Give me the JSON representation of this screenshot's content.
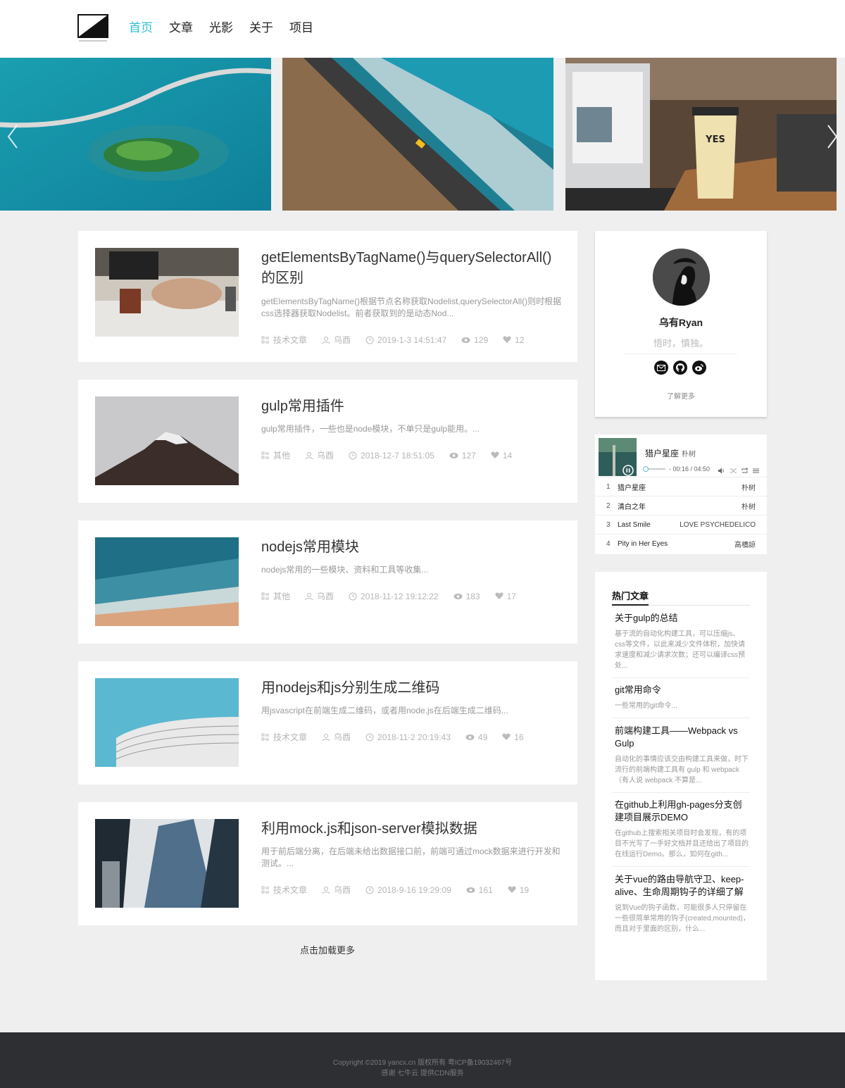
{
  "nav": {
    "items": [
      "首页",
      "文章",
      "光影",
      "关于",
      "项目"
    ]
  },
  "articles": [
    {
      "title": "getElementsByTagName()与querySelectorAll()的区别",
      "summary": "getElementsByTagName()根据节点名称获取Nodelist,querySelectorAll()则时根据css选择器获取Nodelist。前者获取到的是动态Nod...",
      "category": "技术文章",
      "author": "乌酉",
      "date": "2019-1-3 14:51:47",
      "views": "129",
      "likes": "12"
    },
    {
      "title": "gulp常用插件",
      "summary": "gulp常用插件，一些也是node模块，不单只是gulp能用。...",
      "category": "其他",
      "author": "乌酉",
      "date": "2018-12-7 18:51:05",
      "views": "127",
      "likes": "14"
    },
    {
      "title": "nodejs常用模块",
      "summary": "nodejs常用的一些模块、资料和工具等收集...",
      "category": "其他",
      "author": "乌酉",
      "date": "2018-11-12 19:12:22",
      "views": "183",
      "likes": "17"
    },
    {
      "title": "用nodejs和js分别生成二维码",
      "summary": "用jsvascript在前端生成二维码，或者用node.js在后端生成二维码...",
      "category": "技术文章",
      "author": "乌酉",
      "date": "2018-11-2 20:19:43",
      "views": "49",
      "likes": "16"
    },
    {
      "title": "利用mock.js和json-server模拟数据",
      "summary": "用于前后端分离，在后端未给出数据接口前，前端可通过mock数据来进行开发和测试。...",
      "category": "技术文章",
      "author": "乌酉",
      "date": "2018-9-16 19:29:09",
      "views": "161",
      "likes": "19"
    }
  ],
  "load_more": "点击加载更多",
  "profile": {
    "name": "乌有Ryan",
    "motto": "悟时，慎独。",
    "more": "了解更多"
  },
  "player": {
    "song": "猎户星座",
    "artist": "朴树",
    "time": "- 00:16 / 04:50",
    "progress": 0.06,
    "playlist": [
      {
        "num": "1",
        "name": "猎户星座",
        "artist": "朴树"
      },
      {
        "num": "2",
        "name": "清白之年",
        "artist": "朴树"
      },
      {
        "num": "3",
        "name": "Last Smile",
        "artist": "LOVE PSYCHEDELICO"
      },
      {
        "num": "4",
        "name": "Pity in Her Eyes",
        "artist": "高橋諒"
      }
    ]
  },
  "hot": {
    "heading": "热门文章",
    "items": [
      {
        "title": "关于gulp的总结",
        "summary": "基于流的自动化构建工具，可以压缩js、css等文件，以此来减少文件体积，加快请求速度和减少请求次数；还可以编译css预处..."
      },
      {
        "title": "git常用命令",
        "summary": "一些常用的git命令..."
      },
      {
        "title": "前端构建工具——Webpack vs Gulp",
        "summary": "自动化的事情应该交由构建工具来做，时下流行的前端构建工具有 gulp 和 webpack（有人说 webpack 不算是..."
      },
      {
        "title": "在github上利用gh-pages分支创建项目展示DEMO",
        "summary": "在github上搜索相关项目时会发现，有的项目不光写了一手好文档并且还给出了项目的在线运行Demo。那么，如何在gith..."
      },
      {
        "title": "关于vue的路由导航守卫、keep-alive、生命周期钩子的详细了解",
        "summary": "说到Vue的钩子函数，可能很多人只停留在一些很简单常用的钩子(created,mounted)，而且对于里面的区别，什么..."
      }
    ]
  },
  "footer": {
    "line1": "Copyright ©2019 yancx.cn 版权所有 粤ICP备19032467号",
    "line2": "感谢 七牛云 提供CDN服务"
  }
}
